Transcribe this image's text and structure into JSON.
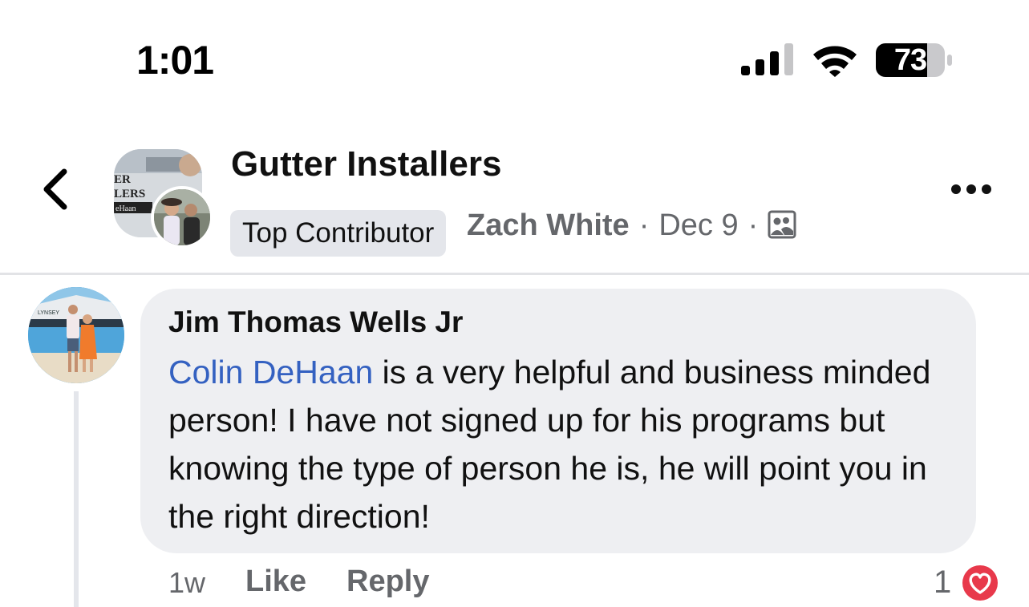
{
  "status_bar": {
    "time": "1:01",
    "battery": "73",
    "icons": [
      "signal-icon",
      "wifi-icon",
      "battery-icon"
    ]
  },
  "header": {
    "group_name": "Gutter Installers",
    "badge": "Top Contributor",
    "author": "Zach White",
    "separator": "·",
    "date": "Dec 9",
    "icons": [
      "back-icon",
      "audience-icon",
      "more-icon"
    ],
    "avatar_text": [
      "ER",
      "LERS",
      "eHaan"
    ]
  },
  "comment": {
    "author": "Jim Thomas Wells Jr",
    "mention": "Colin DeHaan",
    "text": " is a very helpful and business minded person! I have not signed up for his programs but knowing the type of person he is, he will point you in the right direction!",
    "age": "1w",
    "like_label": "Like",
    "reply_label": "Reply",
    "reaction_count": "1",
    "reaction": "heart-icon",
    "avatar_boat_text": "LYNSEY"
  },
  "colors": {
    "mention": "#3461c1",
    "bubble": "#eeeff2",
    "secondary_text": "#65676b",
    "heart": "#e8394b"
  }
}
